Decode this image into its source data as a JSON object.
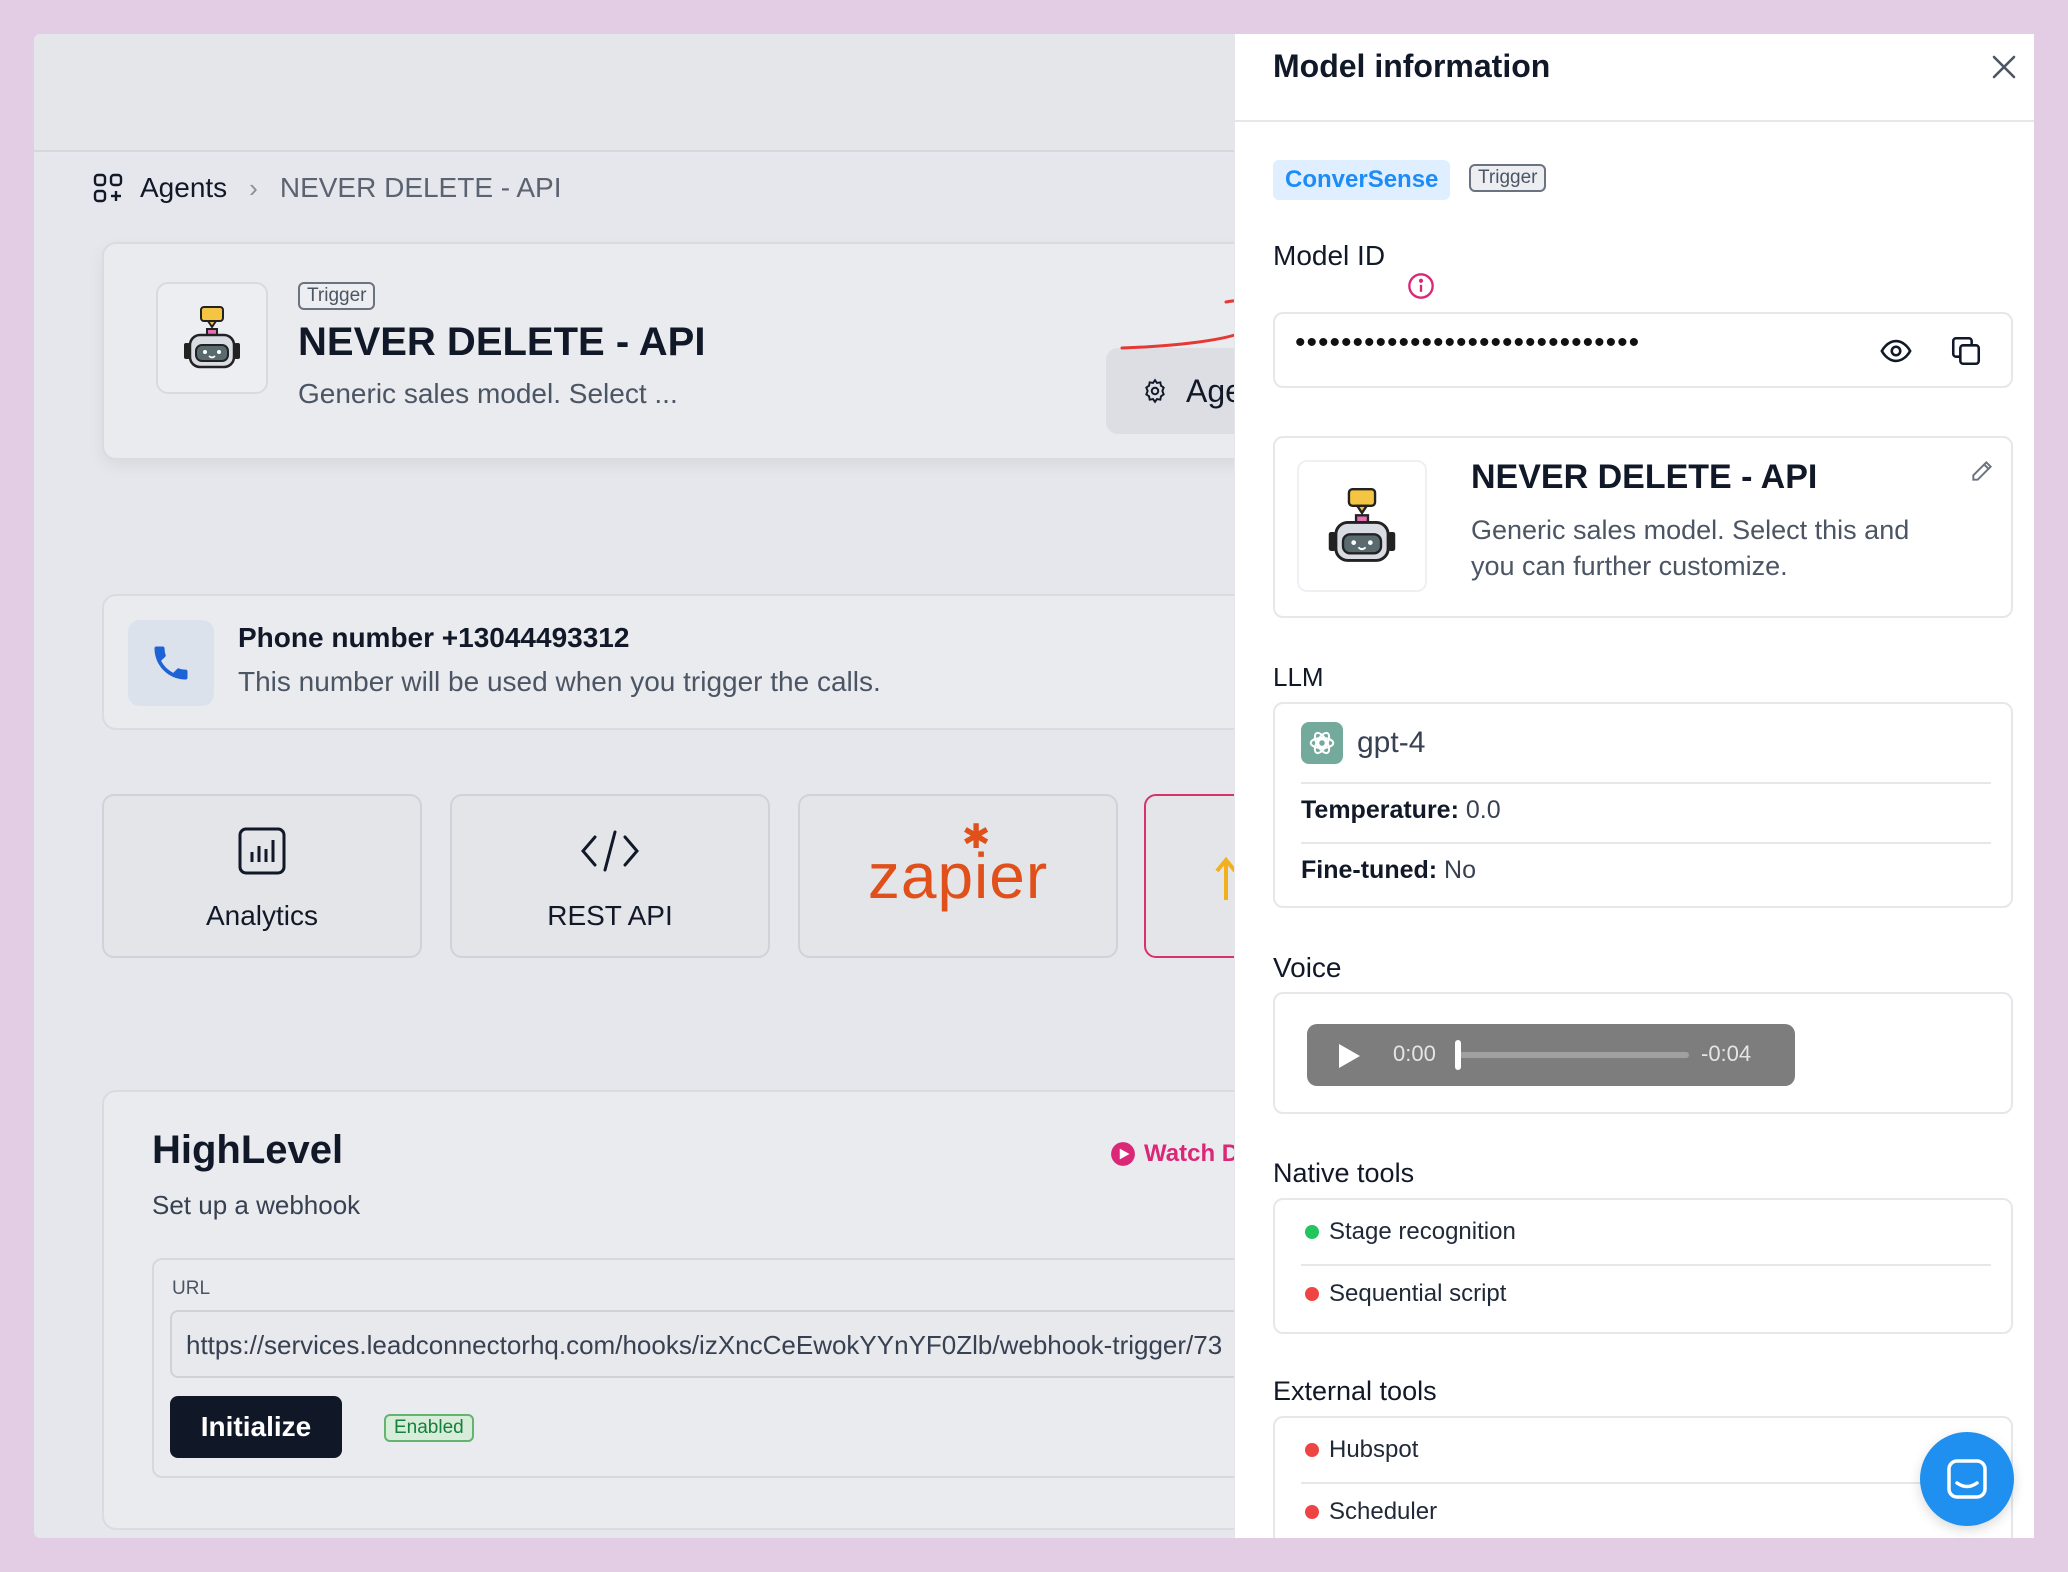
{
  "breadcrumb": {
    "root": "Agents",
    "current": "NEVER DELETE - API"
  },
  "agent": {
    "tag": "Trigger",
    "title": "NEVER DELETE - API",
    "description": "Generic sales model. Select ...",
    "agent_button": "Agent"
  },
  "phone": {
    "title": "Phone number +13044493312",
    "description": "This number will be used when you trigger the calls."
  },
  "tiles": {
    "analytics": "Analytics",
    "rest_api": "REST API",
    "zapier": "zapier"
  },
  "highlevel": {
    "title": "HighLevel",
    "subtitle": "Set up a webhook",
    "watch": "Watch D",
    "url_label": "URL",
    "url_value": "https://services.leadconnectorhq.com/hooks/izXncCeEwokYYnYF0Zlb/webhook-trigger/73",
    "initialize": "Initialize",
    "status": "Enabled"
  },
  "panel": {
    "title": "Model information",
    "brand": "ConverSense",
    "tag": "Trigger",
    "model_id_label": "Model ID",
    "model_id_masked": "••••••••••••••••••••••••••••••",
    "model_title": "NEVER DELETE - API",
    "model_description": "Generic sales model. Select this and you can further customize.",
    "llm_label": "LLM",
    "llm_name": "gpt-4",
    "temperature_key": "Temperature:",
    "temperature_value": "0.0",
    "fine_tuned_key": "Fine-tuned:",
    "fine_tuned_value": "No",
    "voice_label": "Voice",
    "voice_current": "0:00",
    "voice_remaining": "-0:04",
    "voice_progress": 0,
    "native_tools_label": "Native tools",
    "native_tools": [
      {
        "name": "Stage recognition",
        "status": "active"
      },
      {
        "name": "Sequential script",
        "status": "inactive"
      }
    ],
    "external_tools_label": "External tools",
    "external_tools": [
      {
        "name": "Hubspot",
        "status": "inactive"
      },
      {
        "name": "Scheduler",
        "status": "inactive"
      }
    ]
  },
  "colors": {
    "accent_pink": "#db2777",
    "brand_blue": "#1d8cf8",
    "status_green": "#22c55e",
    "status_red": "#ef4444",
    "annotation_red": "#e53935"
  }
}
